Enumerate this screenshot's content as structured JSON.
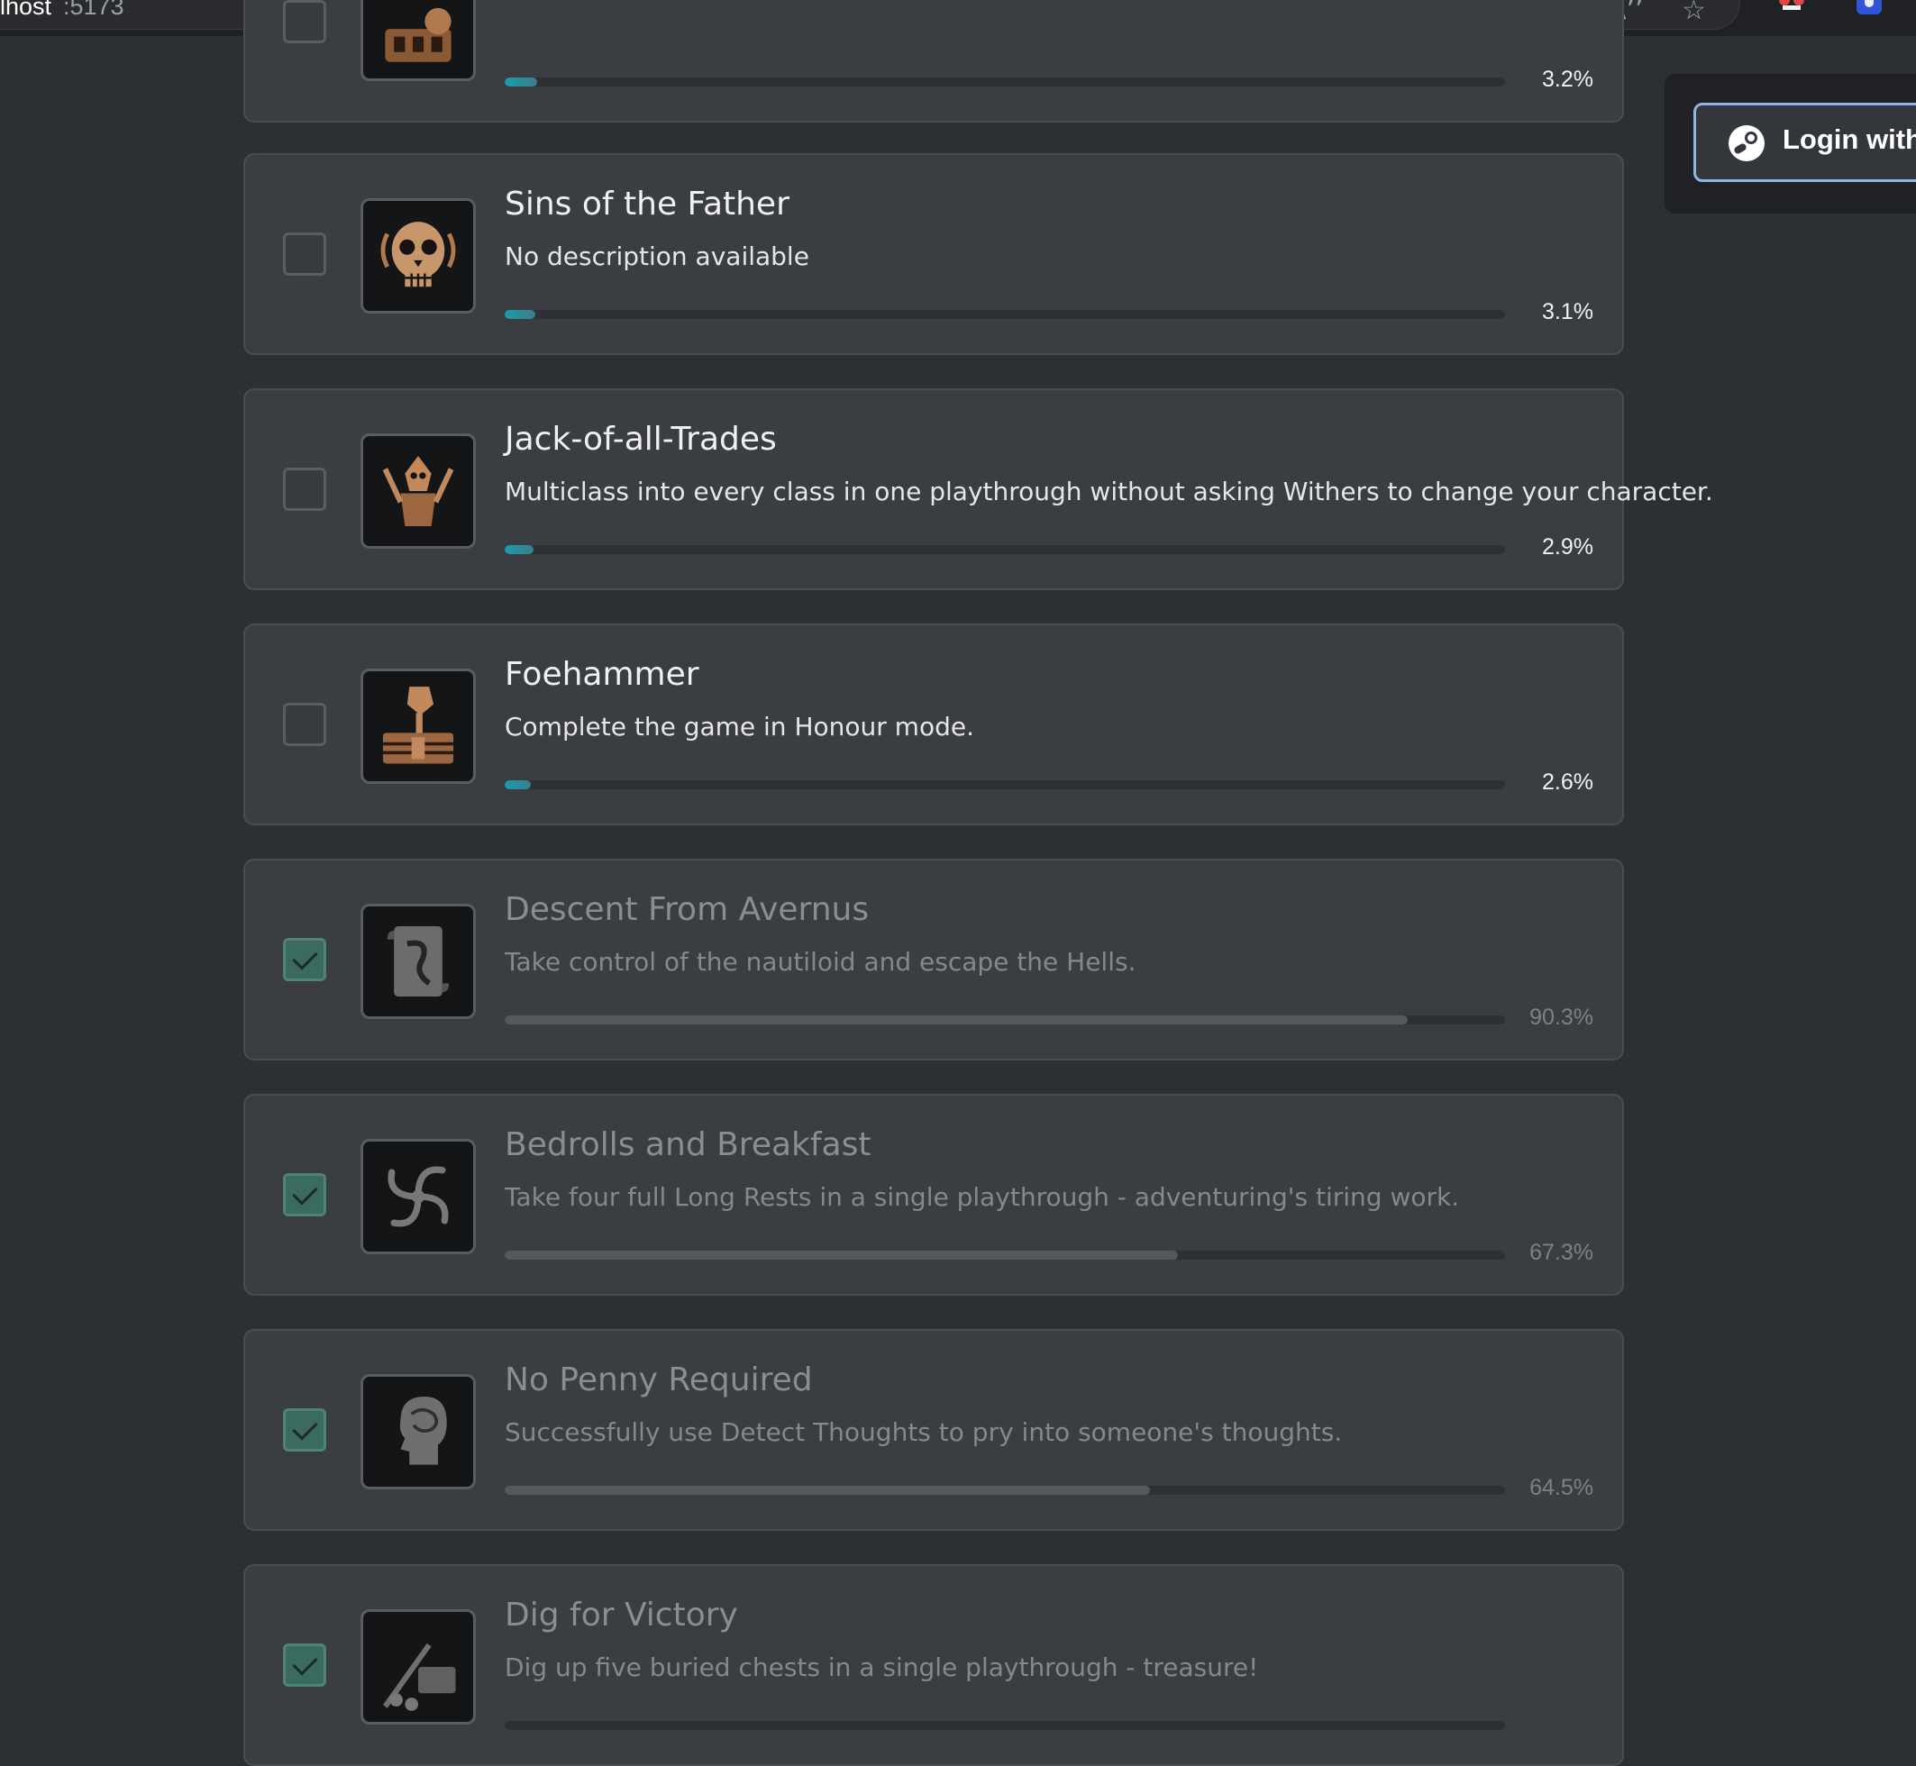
{
  "browser": {
    "host": "lhost",
    "port": ":5173",
    "read_aloud_icon": "A’’",
    "favorite_icon": "☆"
  },
  "login": {
    "label": "Login with"
  },
  "achievements": [
    {
      "title": "",
      "description": "",
      "percent_label": "3.2%",
      "percent": 3.2,
      "completed": false,
      "icon": "chest-figure-icon"
    },
    {
      "title": "Sins of the Father",
      "description": "No description available",
      "percent_label": "3.1%",
      "percent": 3.1,
      "completed": false,
      "icon": "skull-icon"
    },
    {
      "title": "Jack-of-all-Trades",
      "description": "Multiclass into every class in one playthrough without asking Withers to change your character.",
      "percent_label": "2.9%",
      "percent": 2.9,
      "completed": false,
      "icon": "warrior-icon"
    },
    {
      "title": "Foehammer",
      "description": "Complete the game in Honour mode.",
      "percent_label": "2.6%",
      "percent": 2.6,
      "completed": false,
      "icon": "hammer-chest-icon"
    },
    {
      "title": "Descent From Avernus",
      "description": "Take control of the nautiloid and escape the Hells.",
      "percent_label": "90.3%",
      "percent": 90.3,
      "completed": true,
      "icon": "scroll-icon"
    },
    {
      "title": "Bedrolls and Breakfast",
      "description": "Take four full Long Rests in a single playthrough - adventuring's tiring work.",
      "percent_label": "67.3%",
      "percent": 67.3,
      "completed": true,
      "icon": "swirl-icon"
    },
    {
      "title": "No Penny Required",
      "description": "Successfully use Detect Thoughts to pry into someone's thoughts.",
      "percent_label": "64.5%",
      "percent": 64.5,
      "completed": true,
      "icon": "head-brain-icon"
    },
    {
      "title": "Dig for Victory",
      "description": "Dig up five buried chests in a single playthrough - treasure!",
      "percent_label": "",
      "percent": null,
      "completed": true,
      "icon": "shovel-treasure-icon"
    }
  ]
}
